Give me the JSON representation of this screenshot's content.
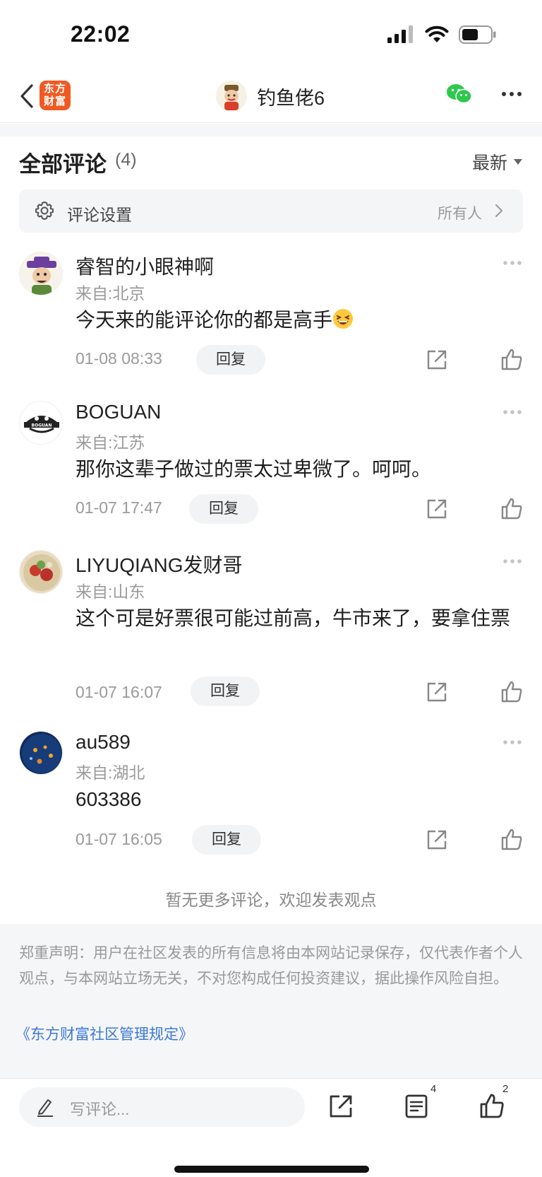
{
  "status_bar": {
    "time": "22:02"
  },
  "nav": {
    "logo_line1": "东方",
    "logo_line2": "财富",
    "title": "钓鱼佬6"
  },
  "comments_section": {
    "title": "全部评论",
    "count": "(4)",
    "sort_label": "最新",
    "settings_label": "评论设置",
    "settings_value": "所有人"
  },
  "comments": [
    {
      "name": "睿智的小眼神啊",
      "location": "来自:北京",
      "text": "今天来的能评论你的都是高手",
      "emoji": "laughing-emoji",
      "time": "01-08 08:33",
      "reply_label": "回复"
    },
    {
      "name": "BOGUAN",
      "location": "来自:江苏",
      "text": "那你这辈子做过的票太过卑微了。呵呵。",
      "time": "01-07 17:47",
      "reply_label": "回复"
    },
    {
      "name": "LIYUQIANG发财哥",
      "location": "来自:山东",
      "text": "这个可是好票很可能过前高，牛市来了，要拿住票",
      "time": "01-07 16:07",
      "reply_label": "回复"
    },
    {
      "name": "au589",
      "location": "来自:湖北",
      "text": "603386",
      "time": "01-07 16:05",
      "reply_label": "回复"
    }
  ],
  "no_more_text": "暂无更多评论，欢迎发表观点",
  "disclaimer": {
    "text": "郑重声明：用户在社区发表的所有信息将由本网站记录保存，仅代表作者个人观点，与本网站立场无关，不对您构成任何投资建议，据此操作风险自担。",
    "link": "《东方财富社区管理规定》"
  },
  "bottom_bar": {
    "placeholder": "写评论...",
    "comments_badge": "4",
    "likes_badge": "2"
  },
  "colors": {
    "brand": "#f05a22",
    "link": "#3a78d6",
    "wechat": "#2dc84d"
  }
}
